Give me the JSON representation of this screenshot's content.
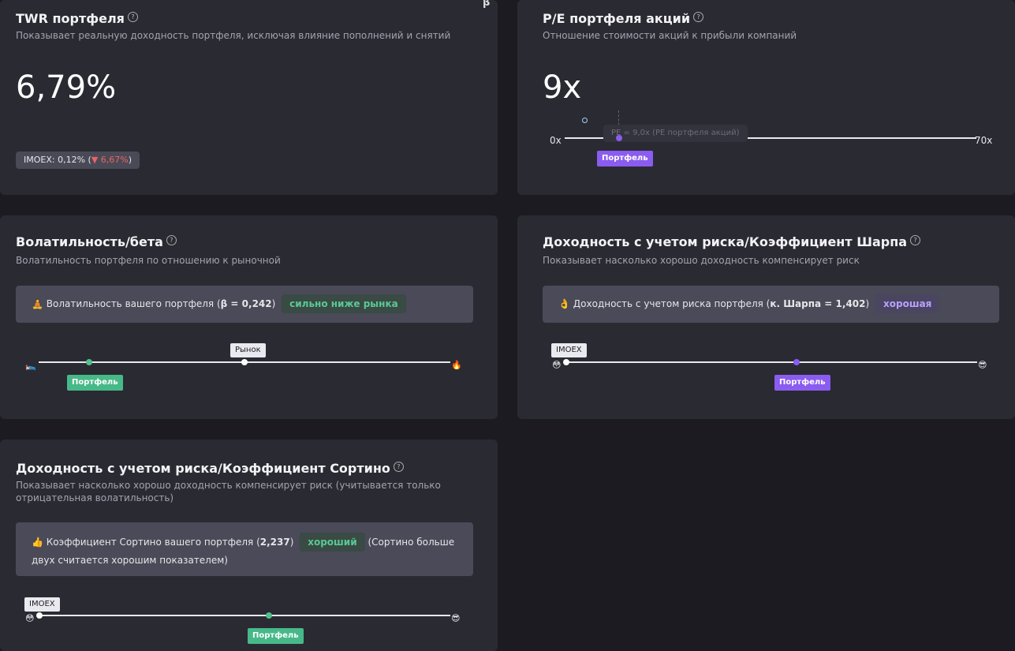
{
  "twr": {
    "title": "TWR портфеля",
    "help": "?",
    "subtitle": "Показывает реальную доходность портфеля, исключая влияние пополнений и снятий",
    "value": "6,79%",
    "imoex_label": "IMOEX: 0,12% (",
    "imoex_arrow": "▼",
    "imoex_diff": "6,67%",
    "imoex_close": ")"
  },
  "corner_symbol": "β",
  "pe": {
    "title": "P/E портфеля акций",
    "help": "?",
    "subtitle": "Отношение стоимости акций к прибыли компаний",
    "value": "9x",
    "axis_min": "0x",
    "axis_max": "70x",
    "tooltip": "PE = 9,0x (PE портфеля акций)",
    "portfolio_label": "Портфель",
    "portfolio_value": 9,
    "range": [
      0,
      70
    ]
  },
  "volatility": {
    "title": "Волатильность/бета",
    "help": "?",
    "subtitle": "Волатильность портфеля по отношению к рыночной",
    "icon": "🧘",
    "text": "Волатильность вашего портфеля (",
    "beta_value": "β = 0,242",
    "text_close": ")",
    "tag": "сильно ниже рынка",
    "market_label": "Рынок",
    "portfolio_label": "Портфель",
    "left_icon": "🛌",
    "right_icon": "🔥",
    "portfolio_fraction": 0.12,
    "market_fraction": 0.5
  },
  "sharpe": {
    "title": "Доходность с учетом риска/Коэффициент Шарпа",
    "help": "?",
    "subtitle": "Показывает насколько хорошо доходность компенсирует риск",
    "icon": "👌",
    "text": "Доходность с учетом риска портфеля (",
    "value": "к. Шарпа = 1,402",
    "text_close": ")",
    "tag": "хорошая",
    "imoex_label": "IMOEX",
    "portfolio_label": "Портфель",
    "left_icon": "😳",
    "right_icon": "😎",
    "portfolio_fraction": 0.56,
    "imoex_fraction": 0.0
  },
  "sortino": {
    "title": "Доходность с учетом риска/Коэффициент Сортино",
    "help": "?",
    "subtitle_line1": "Показывает насколько хорошо доходность компенсирует риск (учитывается только",
    "subtitle_line2": "отрицательная волатильность)",
    "icon": "👍",
    "text": "Коэффициент Сортино вашего портфеля (",
    "value": "2,237",
    "text_close": ")",
    "tag": "хороший",
    "text_after": "(Сортино больше",
    "text_line2": "двух считается хорошим показателем)",
    "imoex_label": "IMOEX",
    "portfolio_label": "Портфель",
    "left_icon": "😳",
    "right_icon": "😎",
    "portfolio_fraction": 0.56,
    "imoex_fraction": 0.0
  }
}
